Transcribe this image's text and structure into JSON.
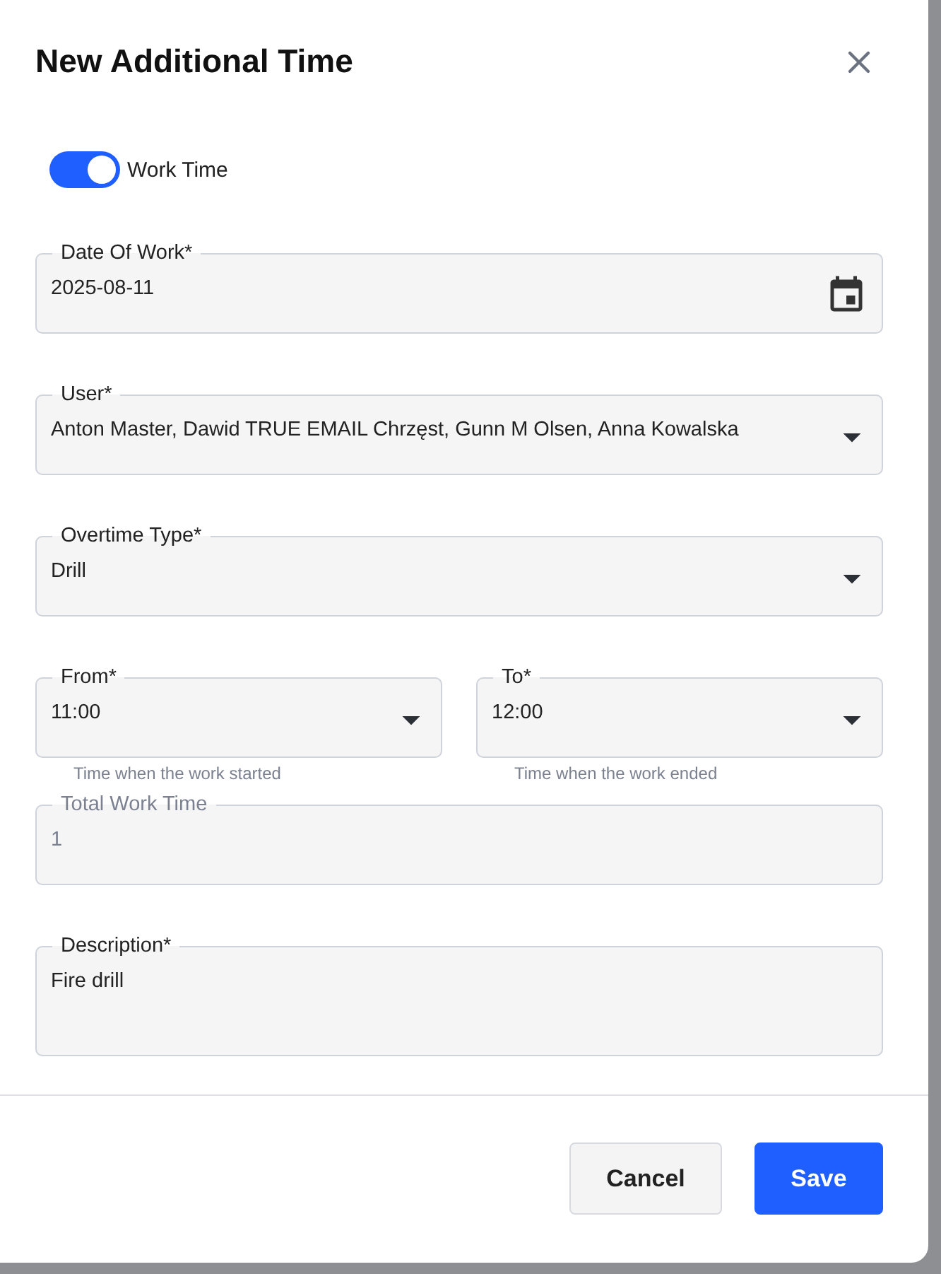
{
  "dialog": {
    "title": "New Additional Time"
  },
  "toggle": {
    "label": "Work Time",
    "on": true
  },
  "rows": [
    {
      "fields": [
        {
          "kind": "date",
          "label": "Date Of Work*",
          "value": "2025-08-11"
        }
      ]
    },
    {
      "fields": [
        {
          "kind": "select",
          "label": "User*",
          "value": "Anton Master, Dawid TRUE EMAIL Chrzęst, Gunn M Olsen, Anna Kowalska"
        }
      ]
    },
    {
      "fields": [
        {
          "kind": "select",
          "label": "Overtime Type*",
          "value": "Drill"
        }
      ]
    },
    {
      "fields": [
        {
          "kind": "select",
          "label": "From*",
          "value": "11:00",
          "helper": "Time when the work started"
        },
        {
          "kind": "select",
          "label": "To*",
          "value": "12:00",
          "helper": "Time when the work ended"
        }
      ]
    },
    {
      "fields": [
        {
          "kind": "text",
          "label": "Total Work Time",
          "value": "1",
          "disabled": true
        }
      ]
    },
    {
      "fields": [
        {
          "kind": "textarea",
          "label": "Description*",
          "value": "Fire drill"
        }
      ]
    }
  ],
  "buttons": [
    {
      "label": "Cancel",
      "kind": "secondary"
    },
    {
      "label": "Save",
      "kind": "primary"
    }
  ]
}
